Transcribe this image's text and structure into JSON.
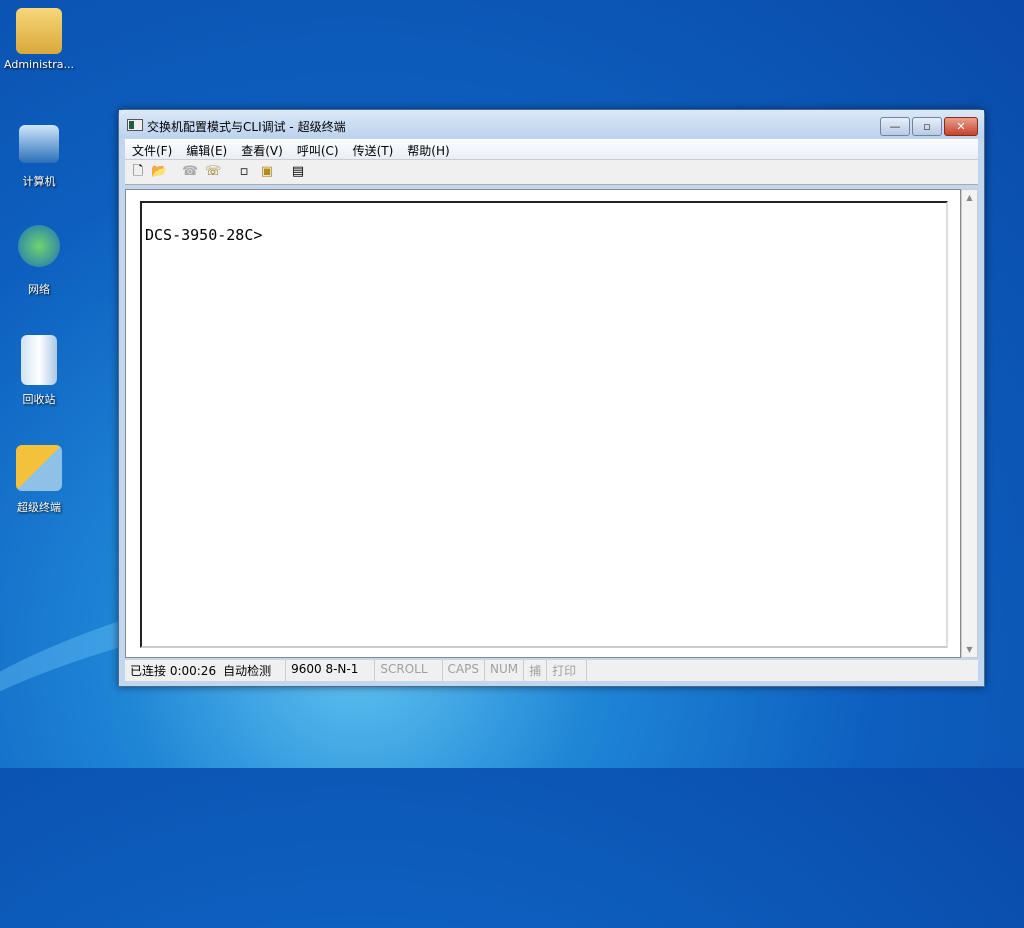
{
  "desktop": {
    "icons": [
      {
        "label": "Administra..."
      },
      {
        "label": "计算机"
      },
      {
        "label": "网络"
      },
      {
        "label": "回收站"
      },
      {
        "label": "超级终端"
      }
    ]
  },
  "window": {
    "title": "交换机配置模式与CLI调试 - 超级终端",
    "controls": {
      "minimize": "—",
      "maximize": "▫",
      "close": "✕"
    },
    "menu": [
      "文件(F)",
      "编辑(E)",
      "查看(V)",
      "呼叫(C)",
      "传送(T)",
      "帮助(H)"
    ],
    "toolbar": [
      "new-icon",
      "open-icon",
      "call-icon",
      "disconnect-icon",
      "send-icon",
      "receive-icon",
      "properties-icon"
    ],
    "terminal": {
      "text": "DCS-3950-28C>"
    },
    "status": {
      "connected": "已连接 0:00:26",
      "detect": "自动检测",
      "port": "9600 8-N-1",
      "scroll": "SCROLL",
      "caps": "CAPS",
      "num": "NUM",
      "capture": "捕",
      "print": "打印"
    }
  }
}
